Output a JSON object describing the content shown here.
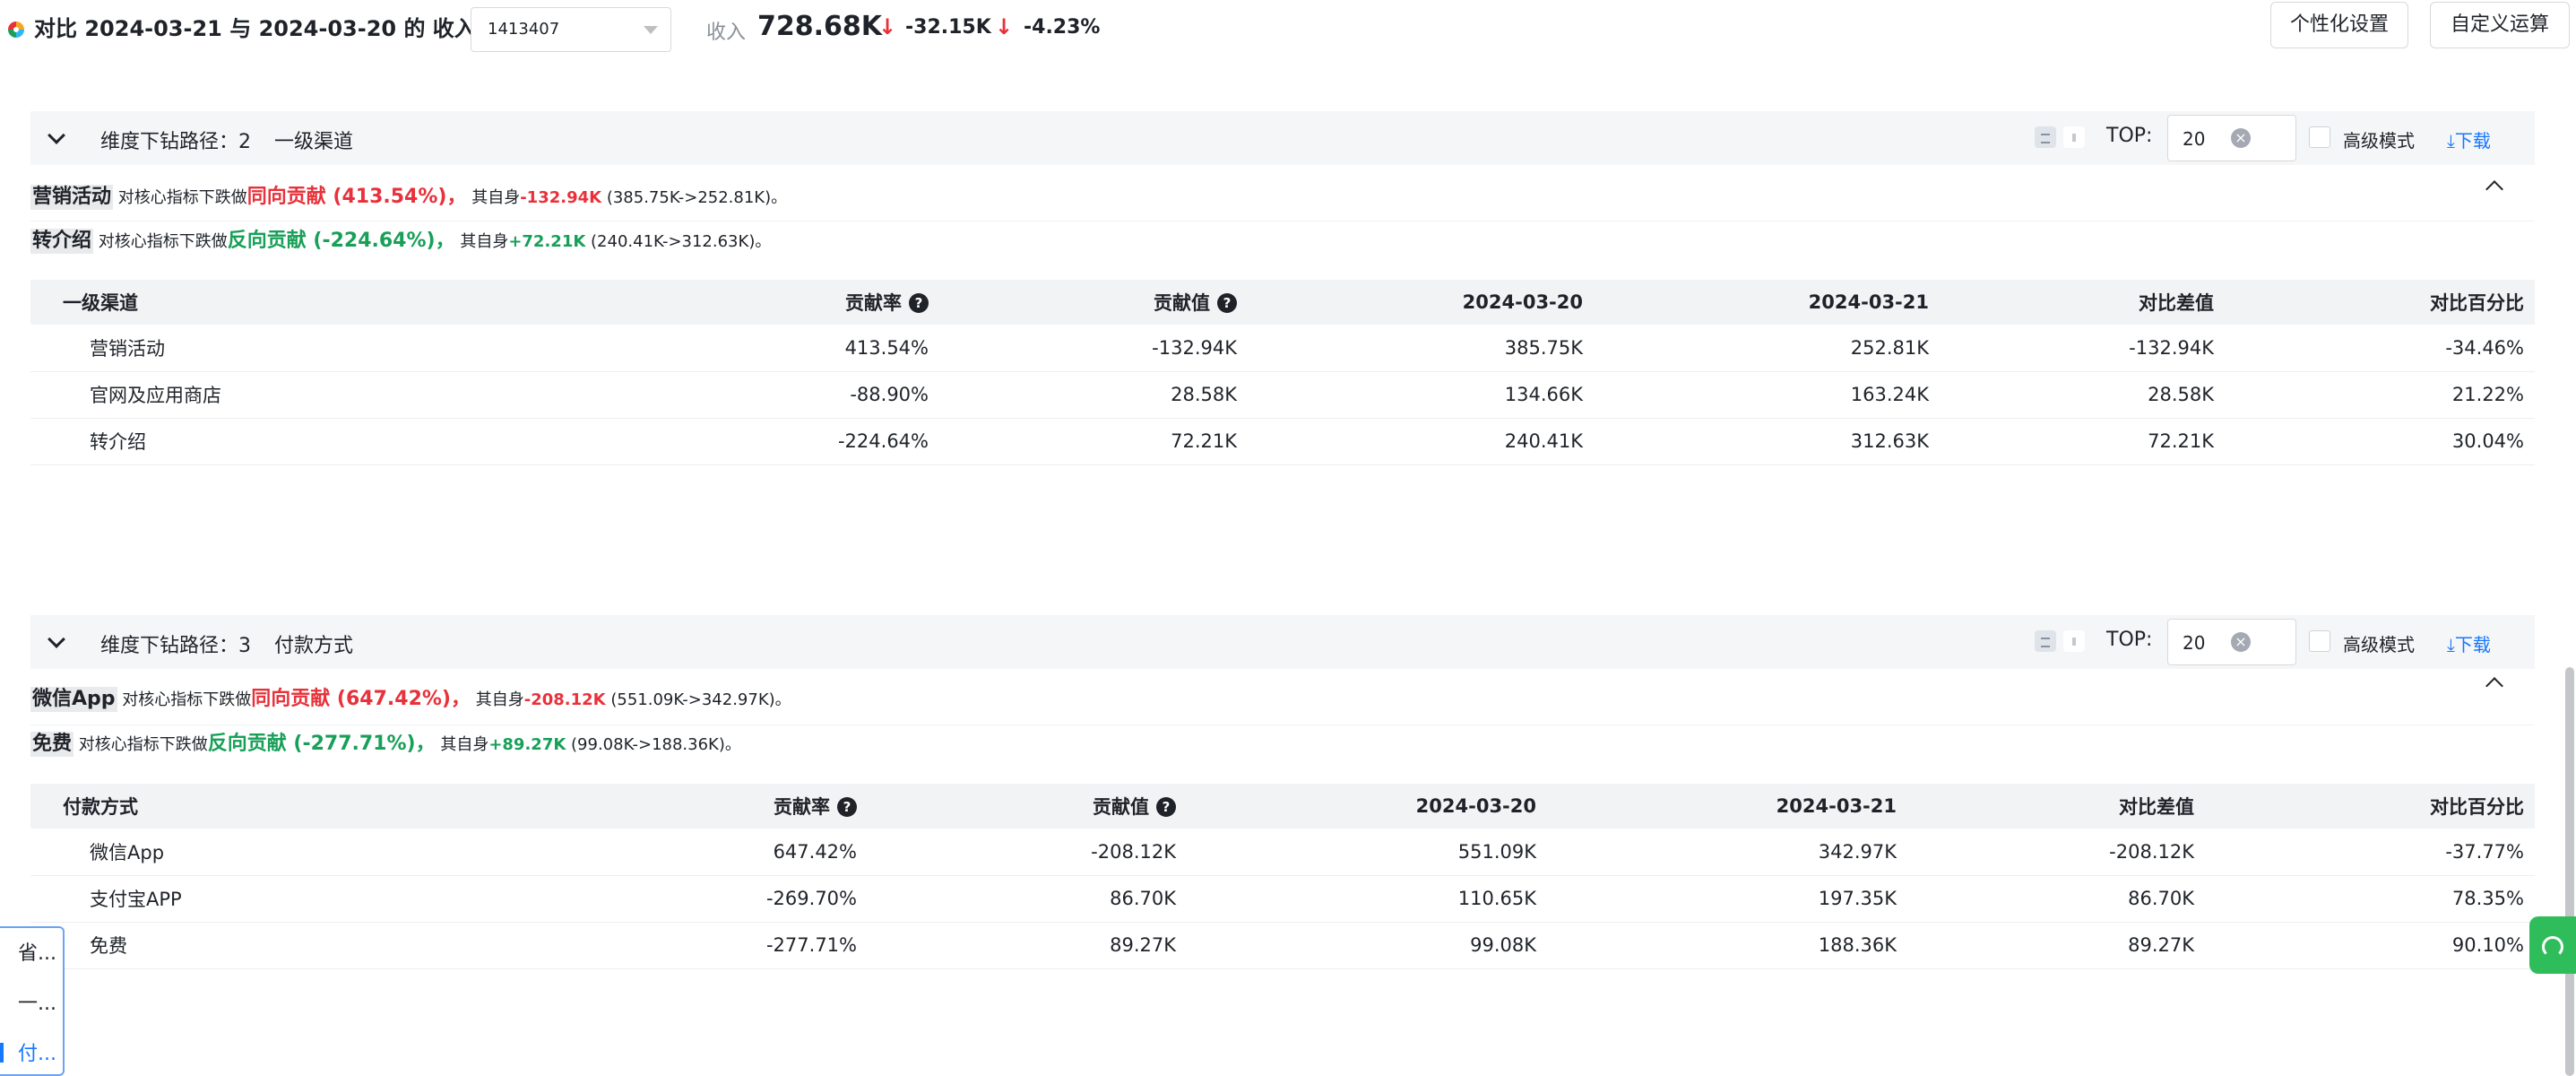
{
  "header": {
    "title": "对比 2024-03-21 与 2024-03-20 的 收入",
    "node_id": "1413407",
    "metric_label": "收入",
    "metric_value": "728.68K",
    "delta_abs": "-32.15K",
    "delta_pct": "-4.23%",
    "btn_personalize": "个性化设置",
    "btn_custom_calc": "自定义运算"
  },
  "panels": [
    {
      "path_label": "维度下钻路径：2",
      "dimension": "一级渠道",
      "top_label": "TOP:",
      "top_value": "20",
      "advanced_label": "高级模式",
      "download_label": "下载",
      "insights": [
        {
          "tag": "营销活动",
          "t1": "对核心指标下跌做",
          "dir": "同向贡献 (413.54%)，",
          "t2": "其自身",
          "self": "-132.94K",
          "range": "(385.75K->252.81K)。"
        },
        {
          "tag": "转介绍",
          "t1": "对核心指标下跌做",
          "dir": "反向贡献 (-224.64%)，",
          "t2": "其自身",
          "self": "+72.21K",
          "range": "(240.41K->312.63K)。"
        }
      ],
      "columns": [
        "一级渠道",
        "贡献率",
        "贡献值",
        "2024-03-20",
        "2024-03-21",
        "对比差值",
        "对比百分比"
      ],
      "rows": [
        [
          "营销活动",
          "413.54%",
          "-132.94K",
          "385.75K",
          "252.81K",
          "-132.94K",
          "-34.46%"
        ],
        [
          "官网及应用商店",
          "-88.90%",
          "28.58K",
          "134.66K",
          "163.24K",
          "28.58K",
          "21.22%"
        ],
        [
          "转介绍",
          "-224.64%",
          "72.21K",
          "240.41K",
          "312.63K",
          "72.21K",
          "30.04%"
        ]
      ]
    },
    {
      "path_label": "维度下钻路径：3",
      "dimension": "付款方式",
      "top_label": "TOP:",
      "top_value": "20",
      "advanced_label": "高级模式",
      "download_label": "下载",
      "insights": [
        {
          "tag": "微信App",
          "t1": "对核心指标下跌做",
          "dir": "同向贡献 (647.42%)，",
          "t2": "其自身",
          "self": "-208.12K",
          "range": "(551.09K->342.97K)。"
        },
        {
          "tag": "免费",
          "t1": "对核心指标下跌做",
          "dir": "反向贡献 (-277.71%)，",
          "t2": "其自身",
          "self": "+89.27K",
          "range": "(99.08K->188.36K)。"
        }
      ],
      "columns": [
        "付款方式",
        "贡献率",
        "贡献值",
        "2024-03-20",
        "2024-03-21",
        "对比差值",
        "对比百分比"
      ],
      "rows": [
        [
          "微信App",
          "647.42%",
          "-208.12K",
          "551.09K",
          "342.97K",
          "-208.12K",
          "-37.77%"
        ],
        [
          "支付宝APP",
          "-269.70%",
          "86.70K",
          "110.65K",
          "197.35K",
          "86.70K",
          "78.35%"
        ],
        [
          "免费",
          "-277.71%",
          "89.27K",
          "99.08K",
          "188.36K",
          "89.27K",
          "90.10%"
        ]
      ]
    }
  ],
  "float_menu": [
    "省...",
    "一...",
    "付..."
  ],
  "colors": {
    "negative": "#e8313a",
    "positive": "#18a058",
    "link": "#1677ff"
  }
}
